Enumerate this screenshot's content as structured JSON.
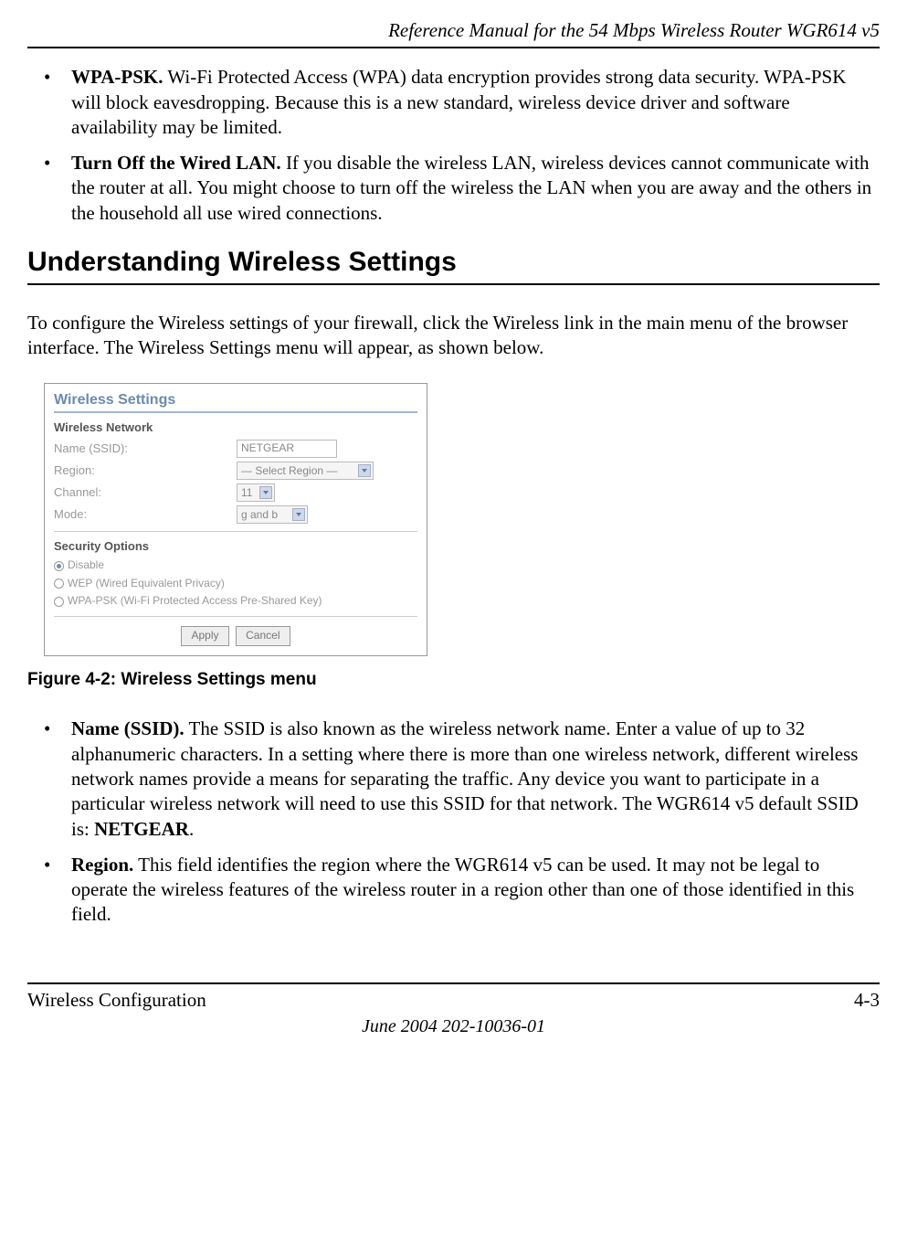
{
  "header": {
    "title": "Reference Manual for the 54 Mbps Wireless Router WGR614 v5"
  },
  "top_bullets": [
    {
      "bold": "WPA-PSK.",
      "text": " Wi-Fi Protected Access (WPA) data encryption provides strong data security. WPA-PSK will block eavesdropping. Because this is a new standard, wireless device driver and software availability may be limited."
    },
    {
      "bold": "Turn Off the Wired LAN.",
      "text": " If you disable the wireless LAN, wireless devices cannot communicate with the router at all. You might choose to turn off the wireless the LAN when you are away and the others in the household all use wired connections."
    }
  ],
  "section_heading": "Understanding Wireless Settings",
  "intro_para": "To configure the Wireless settings of your firewall, click the Wireless link in the main menu of the browser interface. The Wireless Settings menu will appear, as shown below.",
  "wireless_box": {
    "title": "Wireless Settings",
    "network_label": "Wireless Network",
    "rows": {
      "ssid_label": "Name (SSID):",
      "ssid_value": "NETGEAR",
      "region_label": "Region:",
      "region_value": "— Select Region —",
      "channel_label": "Channel:",
      "channel_value": "11",
      "mode_label": "Mode:",
      "mode_value": "g and b"
    },
    "security_label": "Security Options",
    "security_options": {
      "disable": "Disable",
      "wep": "WEP (Wired Equivalent Privacy)",
      "wpa": "WPA-PSK (Wi-Fi Protected Access Pre-Shared Key)"
    },
    "buttons": {
      "apply": "Apply",
      "cancel": "Cancel"
    }
  },
  "figure_caption": "Figure 4-2:  Wireless Settings menu",
  "bottom_bullets": [
    {
      "bold": "Name (SSID).",
      "text_before": " The SSID is also known as the wireless network name. Enter a value of up to 32 alphanumeric characters. In a setting where there is more than one wireless network, different wireless network names provide a means for separating the traffic. Any device you want to participate in a particular wireless network will need to use this SSID for that network. The WGR614 v5 default SSID is: ",
      "bold2": "NETGEAR",
      "text_after": "."
    },
    {
      "bold": "Region.",
      "text_before": " This field identifies the region where the WGR614 v5 can be used. It may not be legal to operate the wireless features of the wireless router in a region other than one of those identified in this field.",
      "bold2": "",
      "text_after": ""
    }
  ],
  "footer": {
    "left": "Wireless Configuration",
    "right": "4-3",
    "date": "June 2004 202-10036-01"
  }
}
